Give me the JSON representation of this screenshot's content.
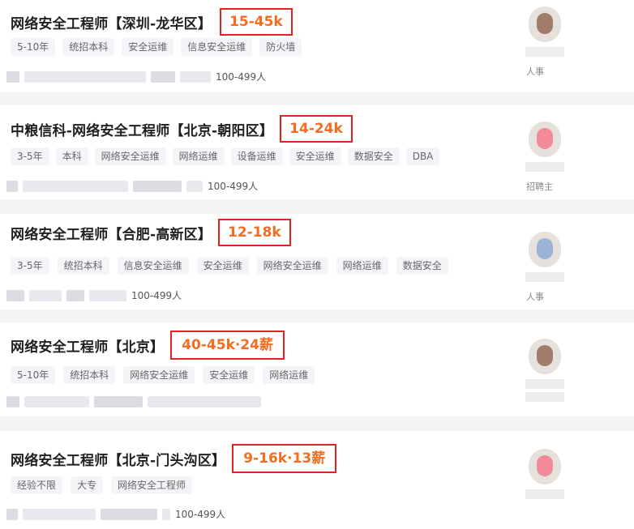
{
  "jobs": [
    {
      "title": "网络安全工程师【深圳-龙华区】",
      "salary": "15-45k",
      "tags": [
        "5-10年",
        "统招本科",
        "安全运维",
        "信息安全运维",
        "防火墙"
      ],
      "company_size": "100-499人",
      "recruiter_role": "人事",
      "avatar_tone": "brown"
    },
    {
      "title": "中粮信科-网络安全工程师【北京-朝阳区】",
      "salary": "14-24k",
      "tags": [
        "3-5年",
        "本科",
        "网络安全运维",
        "网络运维",
        "设备运维",
        "安全运维",
        "数据安全",
        "DBA"
      ],
      "company_size": "100-499人",
      "recruiter_role": "招聘主",
      "avatar_tone": "pink"
    },
    {
      "title": "网络安全工程师【合肥-高新区】",
      "salary": "12-18k",
      "tags": [
        "3-5年",
        "统招本科",
        "信息安全运维",
        "安全运维",
        "网络安全运维",
        "网络运维",
        "数据安全"
      ],
      "company_size": "100-499人",
      "recruiter_role": "人事",
      "avatar_tone": "blue"
    },
    {
      "title": "网络安全工程师【北京】",
      "salary": "40-45k·24薪",
      "tags": [
        "5-10年",
        "统招本科",
        "网络安全运维",
        "安全运维",
        "网络运维"
      ],
      "company_size": "",
      "recruiter_role": "",
      "avatar_tone": "brown"
    },
    {
      "title": "网络安全工程师【北京-门头沟区】",
      "salary": "9-16k·13薪",
      "tags": [
        "经验不限",
        "大专",
        "网络安全工程师"
      ],
      "company_size": "100-499人",
      "recruiter_role": "",
      "avatar_tone": "pink"
    }
  ]
}
